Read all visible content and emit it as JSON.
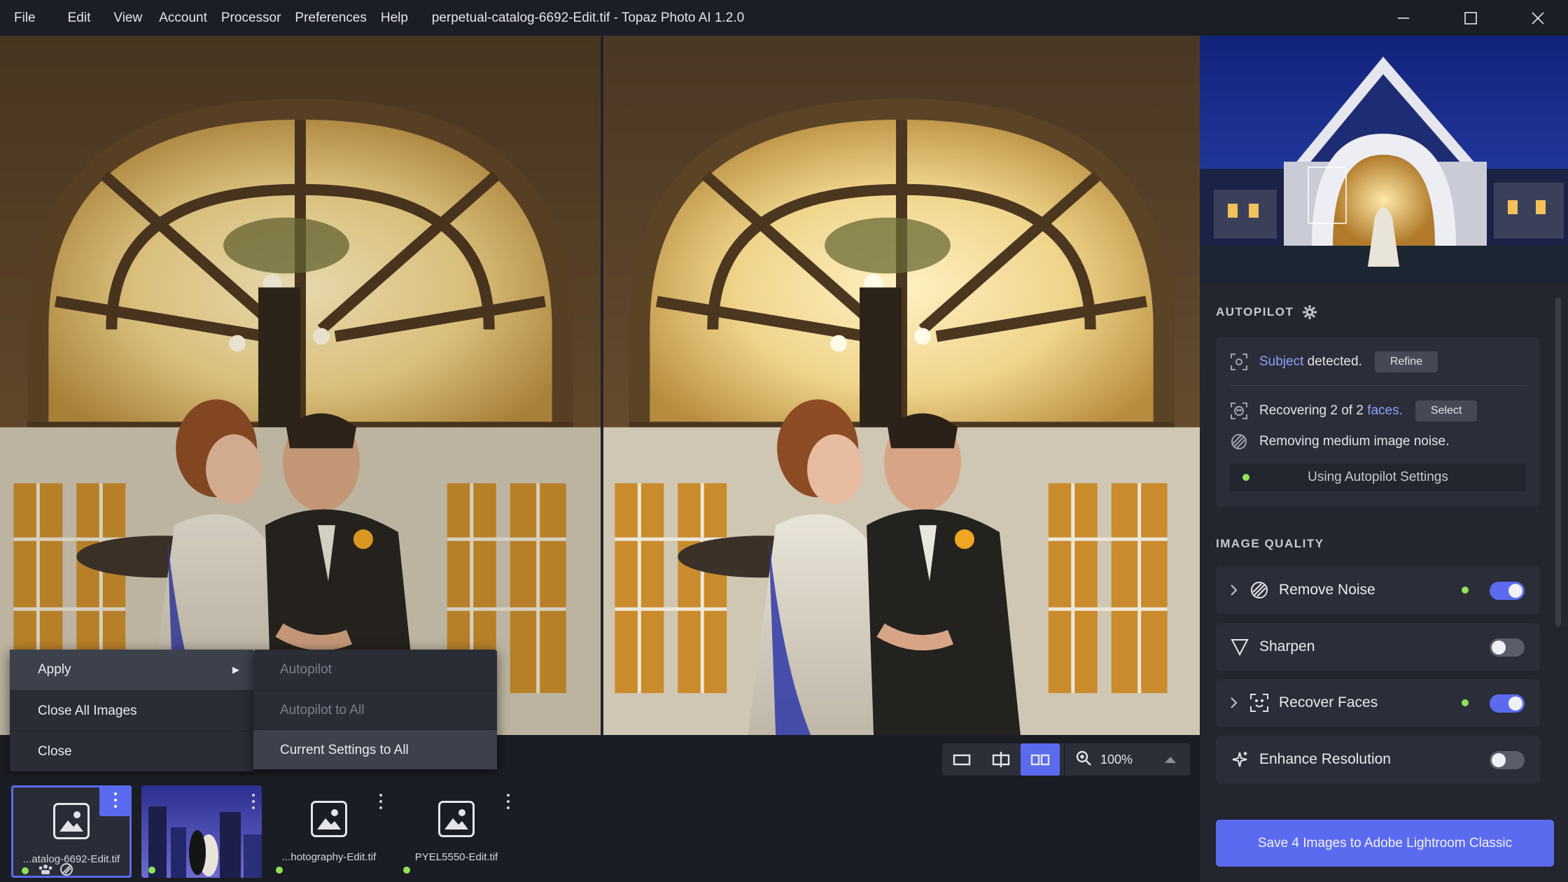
{
  "menu": [
    "File",
    "Edit",
    "View",
    "Account",
    "Processor",
    "Preferences",
    "Help"
  ],
  "window_title": "perpetual-catalog-6692-Edit.tif - Topaz Photo AI 1.2.0",
  "context_menu": {
    "items": [
      {
        "label": "Apply",
        "has_submenu": true
      },
      {
        "label": "Close All Images"
      },
      {
        "label": "Close"
      }
    ],
    "submenu": [
      {
        "label": "Autopilot",
        "enabled": false
      },
      {
        "label": "Autopilot to All",
        "enabled": false
      },
      {
        "label": "Current Settings to All",
        "enabled": true
      }
    ]
  },
  "view_controls": {
    "modes": [
      "single-view-icon",
      "split-view-icon",
      "side-by-side-view-icon"
    ],
    "active_mode": "side-by-side-view-icon",
    "zoom": "100%"
  },
  "filmstrip": [
    {
      "name": "...atalog-6692-Edit.tif",
      "selected": true,
      "thumbnail": "placeholder"
    },
    {
      "name": "",
      "selected": false,
      "thumbnail": "photo"
    },
    {
      "name": "...hotography-Edit.tif",
      "selected": false,
      "thumbnail": "placeholder"
    },
    {
      "name": "PYEL5550-Edit.tif",
      "selected": false,
      "thumbnail": "placeholder"
    }
  ],
  "autopilot": {
    "heading": "AUTOPILOT",
    "subject_link": "Subject",
    "subject_text": "detected.",
    "refine_label": "Refine",
    "faces_text": "Recovering 2 of 2",
    "faces_link": "faces.",
    "select_label": "Select",
    "noise_text": "Removing medium image noise.",
    "status": "Using Autopilot Settings"
  },
  "image_quality": {
    "heading": "IMAGE QUALITY",
    "rows": [
      {
        "label": "Remove Noise",
        "enabled": true,
        "expandable": true,
        "icon": "remove-noise-icon"
      },
      {
        "label": "Sharpen",
        "enabled": false,
        "expandable": false,
        "icon": "sharpen-icon"
      },
      {
        "label": "Recover Faces",
        "enabled": true,
        "expandable": true,
        "icon": "recover-faces-icon"
      },
      {
        "label": "Enhance Resolution",
        "enabled": false,
        "expandable": false,
        "icon": "enhance-resolution-icon"
      }
    ]
  },
  "save_button": "Save 4 Images to Adobe Lightroom Classic",
  "colors": {
    "accent": "#5b6bf0",
    "status_green": "#8fe25a",
    "link": "#8ca2ff"
  }
}
